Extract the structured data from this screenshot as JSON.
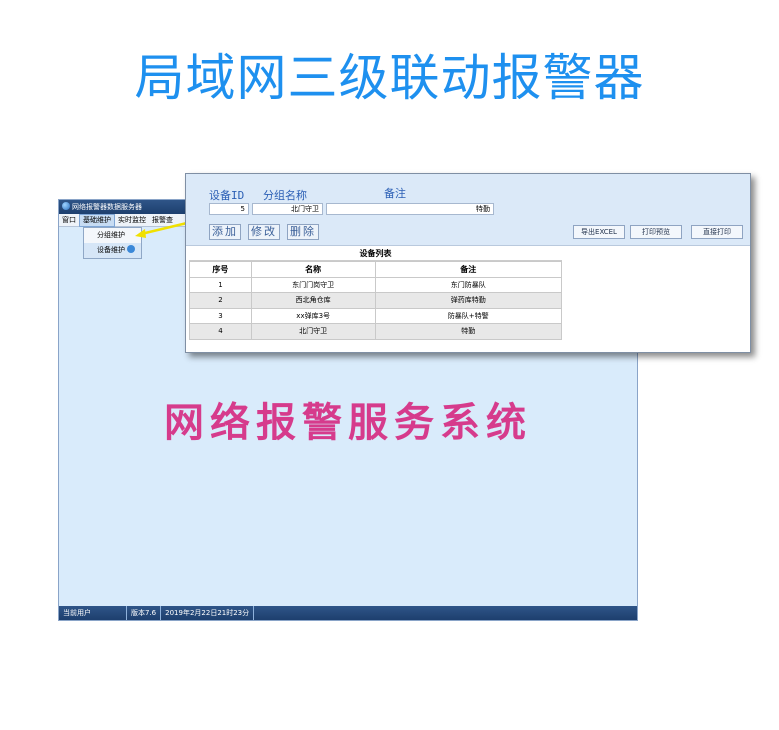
{
  "banner": {
    "title": "局域网三级联动报警器"
  },
  "window": {
    "title": "网络报警器数据服务器",
    "menu": [
      "窗口",
      "基础维护",
      "实时监控",
      "报警查"
    ],
    "dropdown": [
      "分组维护",
      "设备维护"
    ],
    "watermark": "网络报警服务系统",
    "status": {
      "user": "当前用户",
      "version": "版本7.6",
      "datetime": "2019年2月22日21时23分"
    }
  },
  "dialog": {
    "labels": {
      "device_id": "设备ID",
      "group_name": "分组名称",
      "remark": "备注"
    },
    "fields": {
      "device_id": "5",
      "group_name": "北门守卫",
      "remark": "特勤"
    },
    "buttons": {
      "add": "添加",
      "edit": "修改",
      "delete": "删除"
    },
    "right_buttons": {
      "export": "导出EXCEL",
      "preview": "打印预览",
      "print": "直接打印"
    },
    "table": {
      "title": "设备列表",
      "headers": [
        "序号",
        "名称",
        "备注"
      ],
      "rows": [
        [
          "1",
          "东门门岗守卫",
          "东门防暴队"
        ],
        [
          "2",
          "西北角仓库",
          "弹药库特勤"
        ],
        [
          "3",
          "xx弹库3号",
          "防暴队+特警"
        ],
        [
          "4",
          "北门守卫",
          "特勤"
        ]
      ]
    }
  },
  "colors": {
    "banner": "#1e90ef",
    "watermark": "#d63b8c",
    "bar": "#1d3f6e",
    "arrow": "#f0e000"
  }
}
